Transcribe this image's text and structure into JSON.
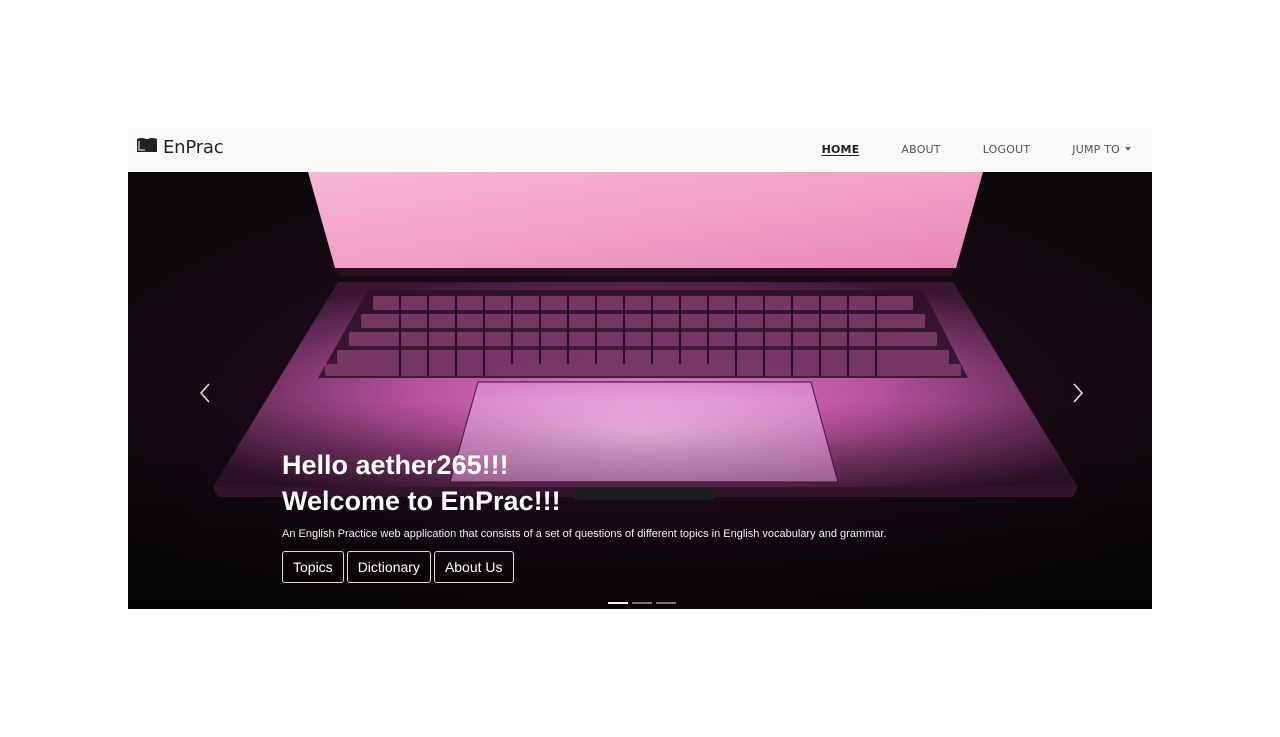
{
  "brand": {
    "name": "EnPrac",
    "icon": "book-icon"
  },
  "nav": {
    "items": [
      {
        "label": "HOME"
      },
      {
        "label": "ABOUT"
      },
      {
        "label": "LOGOUT"
      },
      {
        "label": "JUMP TO"
      }
    ]
  },
  "hero": {
    "greeting": "Hello aether265!!!",
    "welcome": "Welcome to EnPrac!!!",
    "description": "An English Practice web application that consists of a set of questions of different topics in English vocabulary and grammar.",
    "buttons": [
      {
        "label": "Topics"
      },
      {
        "label": "Dictionary"
      },
      {
        "label": "About Us"
      }
    ],
    "slides_count": 3,
    "active_slide": 1,
    "prev_icon": "chevron-left-icon",
    "next_icon": "chevron-right-icon"
  },
  "colors": {
    "navbar_bg": "#f8f9fa",
    "hero_bg": "#1a0b17",
    "screen_pink": "#f3a4cb",
    "accent_magenta": "#c85aa5"
  }
}
